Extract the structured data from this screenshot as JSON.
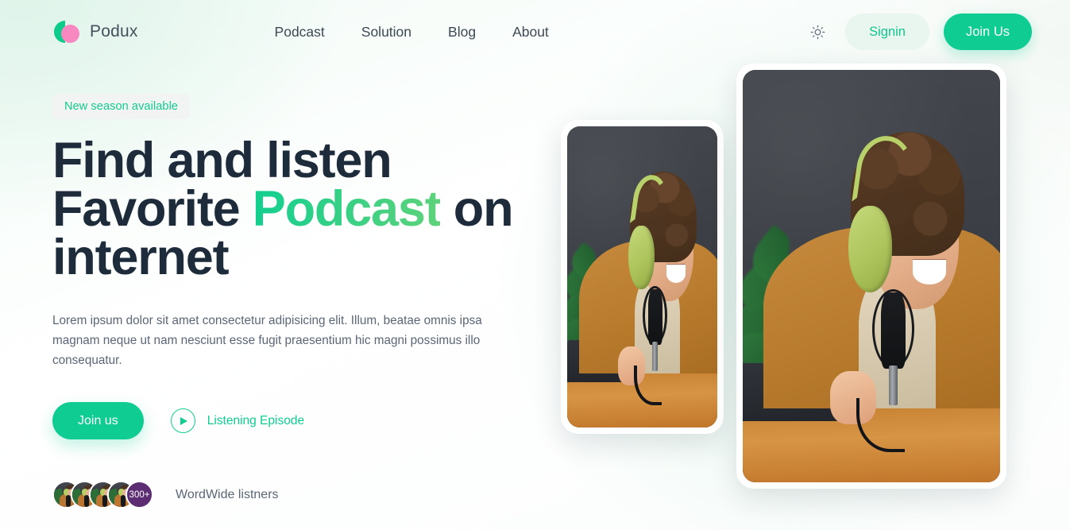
{
  "header": {
    "brand": {
      "name": "Podux",
      "logo_icon": "podux-logo-icon"
    },
    "nav": [
      {
        "label": "Podcast"
      },
      {
        "label": "Solution"
      },
      {
        "label": "Blog"
      },
      {
        "label": "About"
      }
    ],
    "theme_toggle_icon": "sun-icon",
    "signin_label": "Signin",
    "join_us_label": "Join Us"
  },
  "hero": {
    "badge": "New season available",
    "title_line1": "Find and listen",
    "title_line2_pre": "Favorite ",
    "title_accent": "Podcast",
    "title_line2_post": " on",
    "title_line3": "internet",
    "paragraph": "Lorem ipsum dolor sit amet consectetur adipisicing elit. Illum, beatae omnis ipsa magnam neque ut nam nesciunt esse fugit praesentium hic magni possimus illo consequatur.",
    "primary_cta": "Join us",
    "secondary_cta": "Listening Episode",
    "play_icon": "play-icon",
    "listeners_count": "300+",
    "listeners_label": "WordWide listners",
    "avatar_count": 4,
    "image_small_alt": "podcast-host-photo-small",
    "image_large_alt": "podcast-host-photo-large"
  },
  "colors": {
    "accent_green": "#0fcd92",
    "accent_green_light": "#e8f6ef",
    "brand_pink": "#f788c0",
    "heading_navy": "#1e2b3b",
    "body_gray": "#5b6676",
    "count_purple": "#5d2d73"
  }
}
